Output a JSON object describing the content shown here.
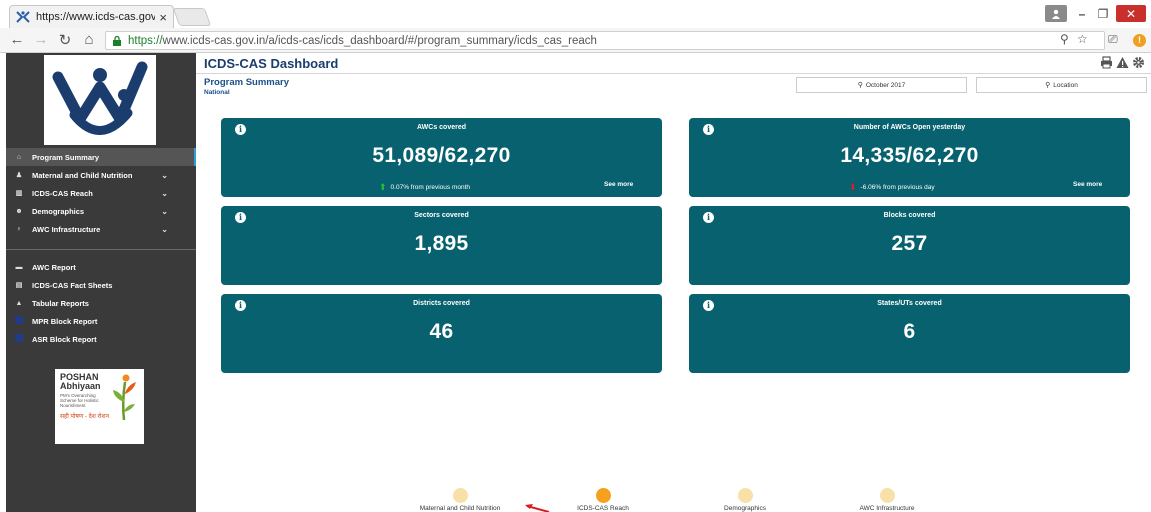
{
  "browser": {
    "tab_title": "https://www.icds-cas.gov",
    "url_secure": "https://",
    "url_rest": "www.icds-cas.gov.in/a/icds-cas/icds_dashboard/#/program_summary/icds_cas_reach"
  },
  "sidebar": {
    "items": [
      {
        "label": "Program Summary",
        "icon": "home-icon",
        "glyph": "⌂"
      },
      {
        "label": "Maternal and Child Nutrition",
        "icon": "child-icon",
        "glyph": "♟"
      },
      {
        "label": "ICDS-CAS Reach",
        "icon": "bar-chart-icon",
        "glyph": "▥"
      },
      {
        "label": "Demographics",
        "icon": "users-icon",
        "glyph": "☻"
      },
      {
        "label": "AWC Infrastructure",
        "icon": "bulb-icon",
        "glyph": "♀"
      }
    ],
    "reports": [
      {
        "label": "AWC Report",
        "icon": "report-icon",
        "glyph": "▬"
      },
      {
        "label": "ICDS-CAS Fact Sheets",
        "icon": "file-icon",
        "glyph": "▤"
      },
      {
        "label": "Tabular Reports",
        "icon": "user-icon",
        "glyph": "▲"
      },
      {
        "label": "MPR Block Report",
        "icon": "square-icon",
        "glyph": ""
      },
      {
        "label": "ASR Block Report",
        "icon": "square-icon",
        "glyph": ""
      }
    ],
    "poshan": {
      "title1": "POSHAN",
      "title2": "Abhiyaan",
      "sub": "PM's Overarching Scheme for Holistic Nourishment",
      "hindi": "सही पोषण - देश रोशन"
    }
  },
  "header": {
    "title": "ICDS-CAS Dashboard",
    "page_title": "Program Summary",
    "page_sub": "National",
    "filter_date": "October 2017",
    "filter_location": "Location"
  },
  "cards": [
    {
      "label": "AWCs covered",
      "value": "51,089/62,270",
      "trend": "0.07% from previous month",
      "trend_dir": "up",
      "see_more": "See more"
    },
    {
      "label": "Number of AWCs Open yesterday",
      "value": "14,335/62,270",
      "trend": "-6.06% from previous day",
      "trend_dir": "down",
      "see_more": "See more"
    },
    {
      "label": "Sectors covered",
      "value": "1,895"
    },
    {
      "label": "Blocks covered",
      "value": "257"
    },
    {
      "label": "Districts covered",
      "value": "46"
    },
    {
      "label": "States/UTs covered",
      "value": "6"
    }
  ],
  "bottom_nav": [
    {
      "label": "Maternal and Child Nutrition",
      "active": false
    },
    {
      "label": "ICDS-CAS Reach",
      "active": true
    },
    {
      "label": "Demographics",
      "active": false
    },
    {
      "label": "AWC Infrastructure",
      "active": false
    }
  ],
  "colors": {
    "card_bg": "#07616e",
    "sidebar_bg": "#3a3a3a",
    "title_blue": "#1a3d6e",
    "active_dot": "#f6a11e",
    "inactive_dot": "#f9e0a8"
  }
}
